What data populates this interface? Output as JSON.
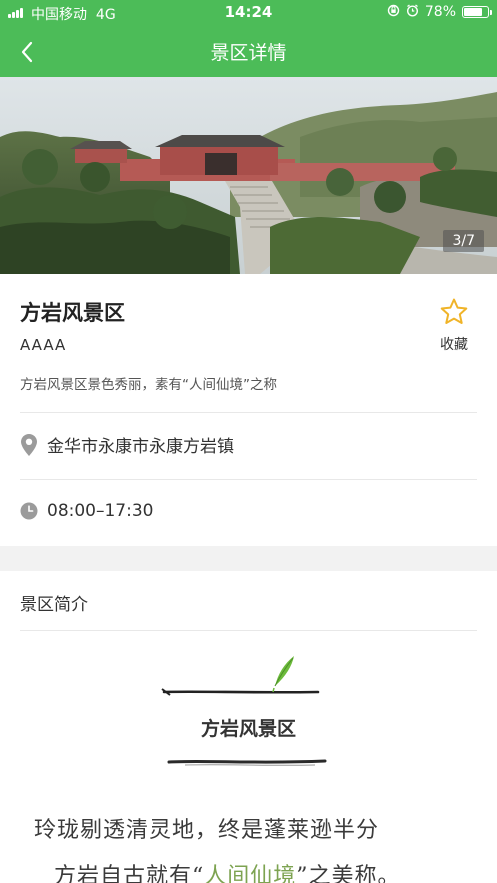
{
  "status_bar": {
    "carrier": "中国移动",
    "network": "4G",
    "time": "14:24",
    "battery": "78%",
    "battery_level": 0.78
  },
  "nav": {
    "title": "景区详情",
    "back_icon": "chevron-left-icon"
  },
  "gallery": {
    "counter": "3/7",
    "current": 3,
    "total": 7
  },
  "scenic": {
    "name": "方岩风景区",
    "level": "AAAA",
    "description": "方岩风景区景色秀丽，素有“人间仙境”之称",
    "favorite_label": "收藏",
    "favorite_icon": "star-outline-icon",
    "address": "金华市永康市永康方岩镇",
    "address_icon": "location-pin-icon",
    "hours": "08:00–17:30",
    "hours_icon": "clock-icon"
  },
  "intro": {
    "section_title": "景区简介",
    "decor_title": "方岩风景区",
    "poem_line1": "玲珑剔透清灵地，终是蓬莱逊半分",
    "poem_line2_prefix": "方岩自古就有“",
    "poem_line2_highlight": "人间仙境",
    "poem_line2_suffix": "”之美称。"
  },
  "colors": {
    "primary": "#4cbc58",
    "star": "#f0b429",
    "highlight": "#7da351"
  }
}
